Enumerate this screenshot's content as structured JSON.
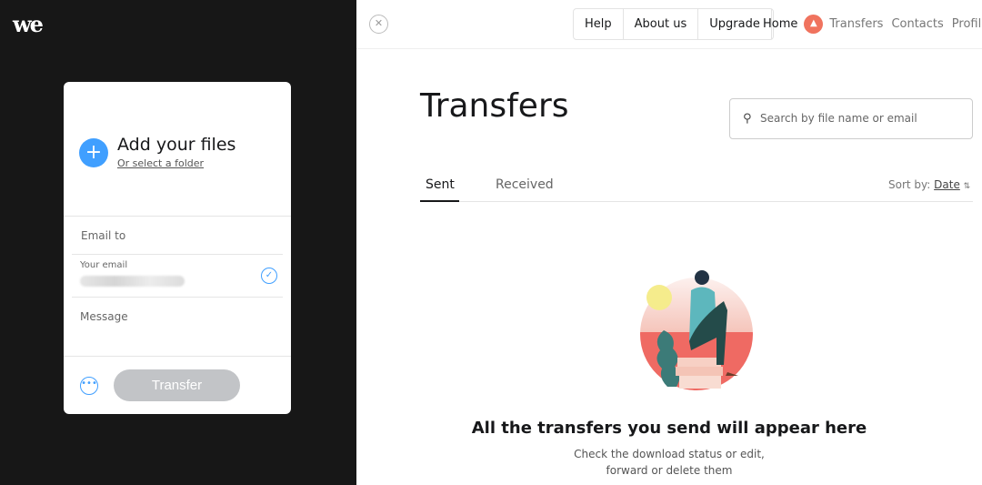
{
  "logo": "we",
  "upload": {
    "add_title": "Add your files",
    "folder_link": "Or select a folder",
    "email_to": "Email to",
    "your_email": "Your email",
    "message": "Message",
    "transfer_button": "Transfer"
  },
  "nav": {
    "items": [
      "Help",
      "About us",
      "Upgrade"
    ],
    "home": "Home",
    "links": [
      "Transfers",
      "Contacts",
      "Profile",
      "A"
    ]
  },
  "main": {
    "title": "Transfers",
    "search_placeholder": "Search by file name or email",
    "tabs": [
      "Sent",
      "Received"
    ],
    "sort_label": "Sort by:",
    "sort_value": "Date",
    "empty_title": "All the transfers you send will appear here",
    "empty_line1": "Check the download status or edit,",
    "empty_line2": "forward or delete them"
  },
  "colors": {
    "accent": "#409fff",
    "avatar": "#f0735e",
    "sidebar": "#171717"
  }
}
